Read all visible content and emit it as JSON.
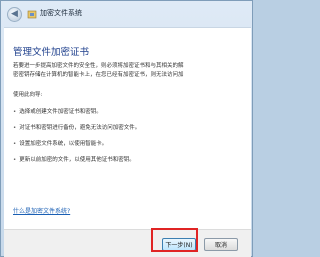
{
  "window": {
    "title": "加密文件系统"
  },
  "icons": {
    "back": "back-arrow-icon",
    "app": "encrypt-key-icon"
  },
  "content": {
    "heading": "管理文件加密证书",
    "intro_lines": [
      "若要进一步提高加密文件的安全性，则必须将加密证书和与其相关的解",
      "密密钥存储在计算机的智能卡上，在您已经有加密证书，则无法访问加"
    ],
    "uses_title": "使用此向导:",
    "bullets": [
      "选择或创建文件加密证书和密钥。",
      "对证书和密钥进行备份，避免无法访问加密文件。",
      "设置加密文件系统，以使用智能卡。",
      "更新以前加密的文件，以使用其他证书和密钥。"
    ],
    "help_link": "什么是加密文件系统?"
  },
  "footer": {
    "next_label": "下一步(N)",
    "cancel_label": "取消"
  },
  "colors": {
    "highlight": "#e02424",
    "heading": "#1e3f8c",
    "link": "#1a5fb4"
  }
}
